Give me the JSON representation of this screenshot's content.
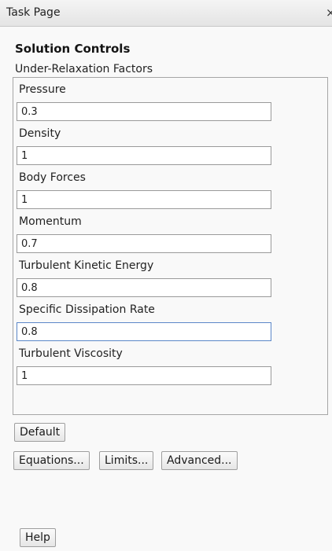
{
  "window": {
    "title": "Task Page",
    "close_glyph": "×",
    "close_icon": "close-icon"
  },
  "panel": {
    "heading": "Solution Controls",
    "group_title": "Under-Relaxation Factors"
  },
  "factors": {
    "pressure": {
      "label": "Pressure",
      "value": "0.3"
    },
    "density": {
      "label": "Density",
      "value": "1"
    },
    "body_forces": {
      "label": "Body Forces",
      "value": "1"
    },
    "momentum": {
      "label": "Momentum",
      "value": "0.7"
    },
    "turbulent_kinetic_energy": {
      "label": "Turbulent Kinetic Energy",
      "value": "0.8"
    },
    "specific_dissipation_rate": {
      "label": "Specific Dissipation Rate",
      "value": "0.8"
    },
    "turbulent_viscosity": {
      "label": "Turbulent Viscosity",
      "value": "1"
    }
  },
  "buttons": {
    "default": "Default",
    "equations": "Equations...",
    "limits": "Limits...",
    "advanced": "Advanced...",
    "help": "Help"
  },
  "colors": {
    "focus_border": "#5b87c8",
    "panel_background": "#f9f9f9"
  }
}
